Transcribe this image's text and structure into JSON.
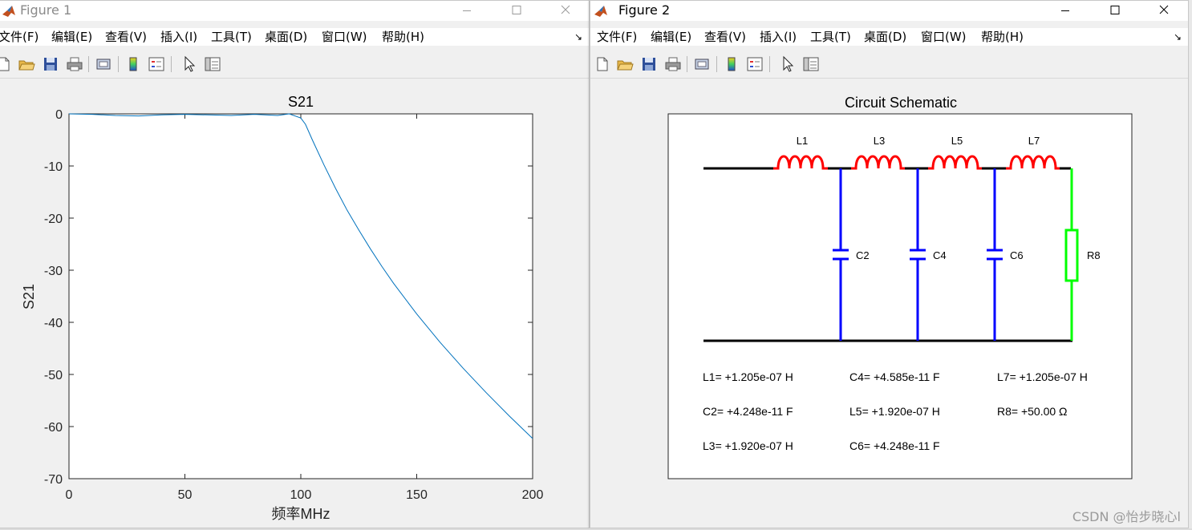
{
  "fig1": {
    "title": "Figure 1",
    "menu": [
      "文件(F)",
      "编辑(E)",
      "查看(V)",
      "插入(I)",
      "工具(T)",
      "桌面(D)",
      "窗口(W)",
      "帮助(H)"
    ],
    "more": "↘",
    "plot_title": "S21",
    "xlabel": "频率MHz",
    "ylabel": "S21",
    "xticks": [
      "0",
      "50",
      "100",
      "150",
      "200"
    ],
    "yticks": [
      "0",
      "-10",
      "-20",
      "-30",
      "-40",
      "-50",
      "-60",
      "-70"
    ]
  },
  "fig2": {
    "title": "Figure 2",
    "menu": [
      "文件(F)",
      "编辑(E)",
      "查看(V)",
      "插入(I)",
      "工具(T)",
      "桌面(D)",
      "窗口(W)",
      "帮助(H)"
    ],
    "more": "↘",
    "plot_title": "Circuit Schematic",
    "inductor_labels": [
      "L1",
      "L3",
      "L5",
      "L7"
    ],
    "capacitor_labels": [
      "C2",
      "C4",
      "C6"
    ],
    "resistor_label": "R8",
    "values": [
      [
        "L1= +1.205e-07 H",
        "C4= +4.585e-11 F",
        "L7= +1.205e-07 H"
      ],
      [
        "C2= +4.248e-11 F",
        "L5= +1.920e-07 H",
        "R8= +50.00 Ω"
      ],
      [
        "L3= +1.920e-07 H",
        "C6= +4.248e-11 F",
        ""
      ]
    ],
    "colors": {
      "inductor": "#ff0000",
      "capacitor": "#0000ff",
      "resistor": "#00ff00",
      "rail": "#000000"
    }
  },
  "chart_data": {
    "type": "line",
    "title": "S21",
    "xlabel": "频率MHz",
    "ylabel": "S21",
    "xlim": [
      0,
      200
    ],
    "ylim": [
      -70,
      0
    ],
    "grid": false,
    "series": [
      {
        "x": [
          0,
          10,
          20,
          30,
          40,
          50,
          60,
          70,
          80,
          90,
          95,
          100,
          102,
          105,
          110,
          115,
          120,
          125,
          130,
          135,
          140,
          150,
          160,
          170,
          180,
          190,
          200
        ],
        "y": [
          0,
          -0.1,
          -0.3,
          -0.4,
          -0.2,
          -0.1,
          -0.2,
          -0.3,
          -0.1,
          -0.3,
          0,
          -0.8,
          -2.0,
          -5.0,
          -9.8,
          -14.3,
          -18.5,
          -22.3,
          -25.9,
          -29.3,
          -32.5,
          -38.4,
          -43.8,
          -48.8,
          -53.5,
          -58.0,
          -62.3
        ]
      }
    ]
  },
  "watermark": "CSDN @怡步晓心l"
}
